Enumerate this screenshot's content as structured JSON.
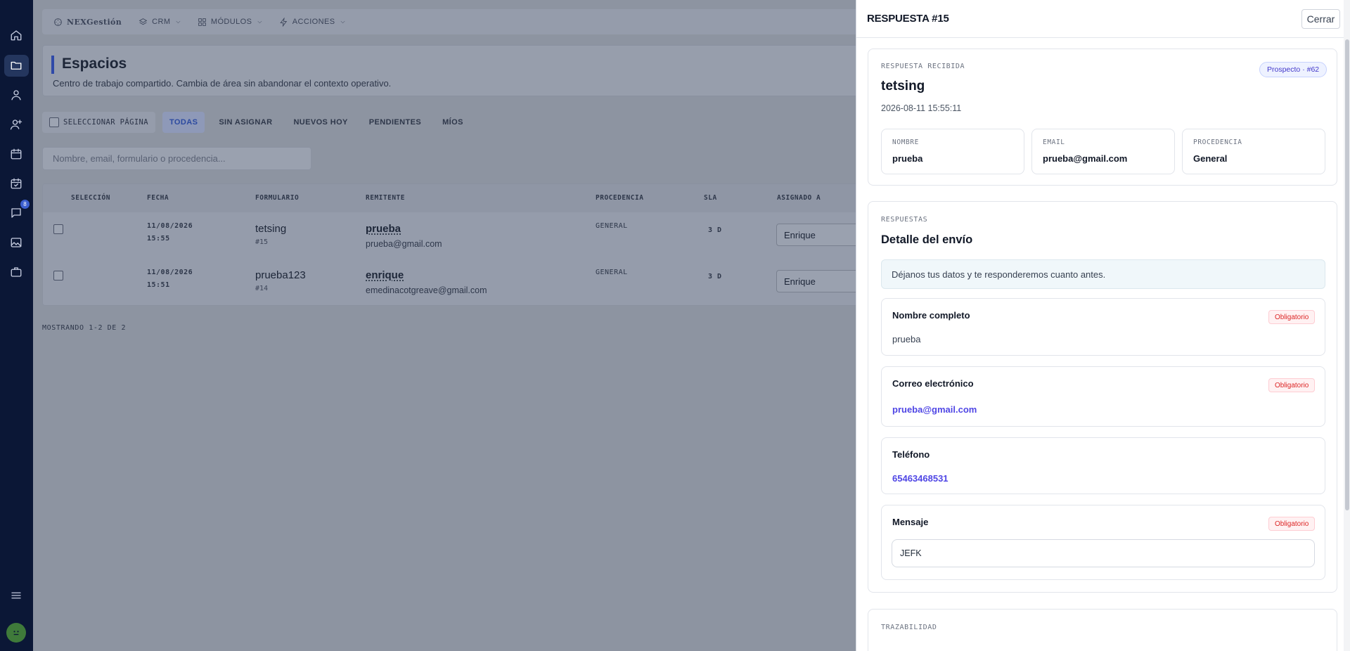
{
  "sidebar": {
    "icons": [
      "home-icon",
      "folder-icon",
      "user-icon",
      "user-plus-icon",
      "calendar-icon",
      "calendar-check-icon",
      "chat-icon",
      "image-icon",
      "briefcase-icon"
    ],
    "badge": "8",
    "menu_icon": "menu-icon"
  },
  "topbar": {
    "brand": "NEXGestión",
    "nav": [
      {
        "label": "CRM",
        "icon": "layers-icon"
      },
      {
        "label": "MÓDULOS",
        "icon": "grid-icon"
      },
      {
        "label": "ACCIONES",
        "icon": "bolt-icon"
      }
    ]
  },
  "header": {
    "title": "Espacios",
    "subtitle": "Centro de trabajo compartido. Cambia de área sin abandonar el contexto operativo."
  },
  "filters": {
    "select_page": "SELECCIONAR PÁGINA",
    "tabs": [
      "TODAS",
      "SIN ASIGNAR",
      "NUEVOS HOY",
      "PENDIENTES",
      "MÍOS"
    ],
    "active_tab": "TODAS"
  },
  "search": {
    "placeholder": "Nombre, email, formulario o procedencia..."
  },
  "table": {
    "columns": [
      "SELECCIÓN",
      "FECHA",
      "FORMULARIO",
      "REMITENTE",
      "PROCEDENCIA",
      "SLA",
      "ASIGNADO A"
    ],
    "rows": [
      {
        "date": "11/08/2026",
        "time": "15:55",
        "form": "tetsing",
        "form_id": "#15",
        "sender": "prueba",
        "sender_email": "prueba@gmail.com",
        "origin": "GENERAL",
        "sla": "3 D",
        "assigned": "Enrique"
      },
      {
        "date": "11/08/2026",
        "time": "15:51",
        "form": "prueba123",
        "form_id": "#14",
        "sender": "enrique",
        "sender_email": "emedinacotgreave@gmail.com",
        "origin": "GENERAL",
        "sla": "3 D",
        "assigned": "Enrique"
      }
    ]
  },
  "showing": "MOSTRANDO 1-2 DE 2",
  "drawer": {
    "title": "RESPUESTA #15",
    "close_label": "Cerrar",
    "received": {
      "eyebrow": "RESPUESTA RECIBIDA",
      "badge": "Prospecto · #62",
      "name": "tetsing",
      "timestamp": "2026-08-11 15:55:11",
      "meta": [
        {
          "label": "NOMBRE",
          "value": "prueba"
        },
        {
          "label": "EMAIL",
          "value": "prueba@gmail.com"
        },
        {
          "label": "PROCEDENCIA",
          "value": "General"
        }
      ]
    },
    "answers": {
      "eyebrow": "RESPUESTAS",
      "title": "Detalle del envío",
      "intro": "Déjanos tus datos y te responderemos cuanto antes.",
      "required_label": "Obligatorio",
      "fields": [
        {
          "label": "Nombre completo",
          "value": "prueba",
          "required": true
        },
        {
          "label": "Correo electrónico",
          "value": "prueba@gmail.com",
          "required": true
        },
        {
          "label": "Teléfono",
          "value": "65463468531",
          "required": false
        },
        {
          "label": "Mensaje",
          "value": "JEFK",
          "required": true
        }
      ]
    },
    "traceability": {
      "eyebrow": "TRAZABILIDAD"
    }
  }
}
